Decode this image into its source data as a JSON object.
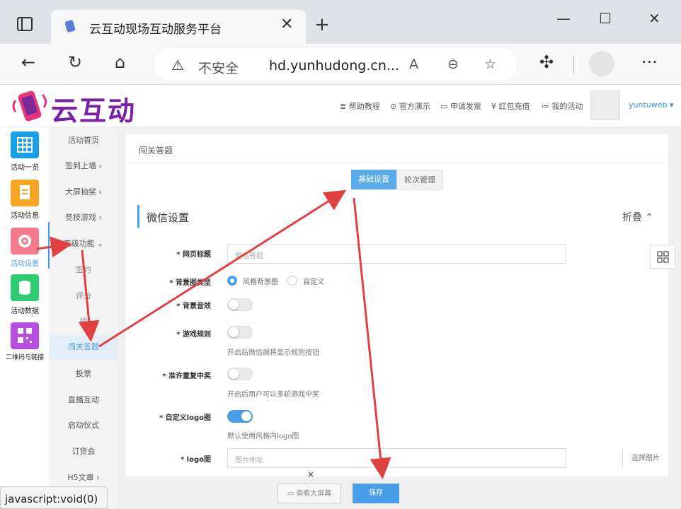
{
  "browser": {
    "tab_title": "云互动现场互动服务平台",
    "tab_close": "✕",
    "new_tab": "+",
    "insecure_label": "不安全",
    "url": "hd.yunhudong.cn...",
    "window_buttons": [
      "—",
      "☐",
      "✕"
    ],
    "status_text": "javascript:void(0)"
  },
  "header": {
    "logo": "云互动",
    "links": [
      "帮助教程",
      "官方演示",
      "申请发票",
      "红包充值",
      "我的活动"
    ],
    "link_icons": [
      "≣",
      "⊙",
      "▭",
      "¥",
      "≔"
    ],
    "username": "yuntuweb"
  },
  "left_sidebar": [
    {
      "label": "活动一览",
      "color": "#1aa0e8"
    },
    {
      "label": "活动信息",
      "color": "#f5a623"
    },
    {
      "label": "活动设置",
      "color": "#f37b8c"
    },
    {
      "label": "活动数据",
      "color": "#2ecc71"
    },
    {
      "label": "二维码与链接",
      "color": "#b84ee0"
    }
  ],
  "sub_menu": [
    {
      "label": "活动首页",
      "arrow": ""
    },
    {
      "label": "签到上墙",
      "arrow": "›"
    },
    {
      "label": "大屏抽奖",
      "arrow": "›"
    },
    {
      "label": "竞技游戏",
      "arrow": "›"
    },
    {
      "label": "高级功能",
      "arrow": "⌄"
    },
    {
      "label": "签约",
      "arrow": ""
    },
    {
      "label": "评分",
      "arrow": ""
    },
    {
      "label": "拍",
      "arrow": ""
    },
    {
      "label": "闯关答题",
      "arrow": ""
    },
    {
      "label": "投票",
      "arrow": ""
    },
    {
      "label": "直播互动",
      "arrow": ""
    },
    {
      "label": "启动仪式",
      "arrow": ""
    },
    {
      "label": "订货会",
      "arrow": ""
    },
    {
      "label": "H5文章",
      "arrow": "›"
    }
  ],
  "main": {
    "breadcrumb": "闯关答题",
    "tabs": [
      "基础设置",
      "轮次管理"
    ],
    "section_title": "微信设置",
    "fold_label": "折叠 ⌃",
    "fields": {
      "page_title_label": "* 网页标题",
      "page_title_placeholder": "微信答题",
      "bg_type_label": "* 背景图类型",
      "bg_type_opt1": "风格背景图",
      "bg_type_opt2": "自定义",
      "bg_sound_label": "* 背景音效",
      "rules_label": "* 游戏规则",
      "rules_hint": "开启后微信端将显示规则按钮",
      "repeat_label": "* 准许重复中奖",
      "repeat_hint": "开启后用户可以多轮游戏中奖",
      "custom_logo_label": "* 自定义logo图",
      "custom_logo_hint": "默认使用风格内logo图",
      "logo_label": "* logo图",
      "logo_placeholder": "图片地址",
      "logo_pick": "选择图片"
    },
    "close_x": "×",
    "footer": {
      "view_screen": "查看大屏幕",
      "save": "保存"
    }
  },
  "colors": {
    "accent": "#4a9ee8",
    "arrow": "#e04040"
  }
}
